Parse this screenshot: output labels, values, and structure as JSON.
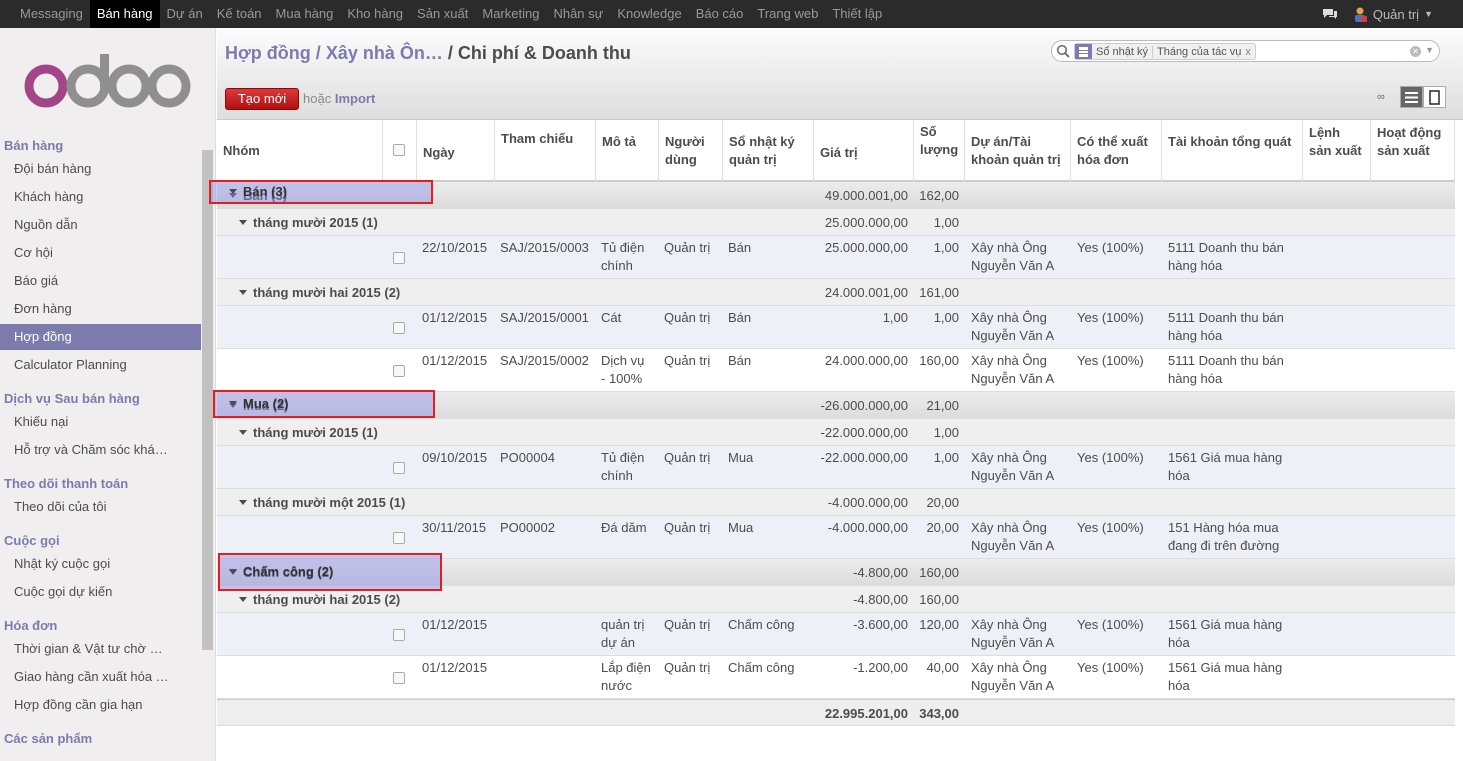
{
  "topbar": {
    "menu": [
      "Messaging",
      "Bán hàng",
      "Dự án",
      "Kế toán",
      "Mua hàng",
      "Kho hàng",
      "Sản xuất",
      "Marketing",
      "Nhân sự",
      "Knowledge",
      "Báo cáo",
      "Trang web",
      "Thiết lập"
    ],
    "active_menu": "Bán hàng",
    "user": "Quản trị"
  },
  "sidebar": {
    "sections": [
      {
        "title": "Bán hàng",
        "items": [
          "Đội bán hàng",
          "Khách hàng",
          "Nguồn dẫn",
          "Cơ hội",
          "Báo giá",
          "Đơn hàng",
          "Hợp đồng",
          "Calculator Planning"
        ]
      },
      {
        "title": "Dịch vụ Sau bán hàng",
        "items": [
          "Khiếu nại",
          "Hỗ trợ và Chăm sóc khá…"
        ]
      },
      {
        "title": "Theo dõi thanh toán",
        "items": [
          "Theo dõi của tôi"
        ]
      },
      {
        "title": "Cuộc gọi",
        "items": [
          "Nhật ký cuộc gọi",
          "Cuộc gọi dự kiến"
        ]
      },
      {
        "title": "Hóa đơn",
        "items": [
          "Thời gian & Vật tư chờ …",
          "Giao hàng cần xuất hóa …",
          "Hợp đồng cần gia hạn"
        ]
      },
      {
        "title": "Các sản phẩm",
        "items": []
      }
    ],
    "active_item": "Hợp đồng"
  },
  "header": {
    "breadcrumb_1": "Hợp đồng",
    "sep": "/",
    "breadcrumb_2": "Xây nhà Ôn…",
    "current": "/ Chi phí & Doanh thu",
    "search": {
      "facet_field": "Sổ nhật ký",
      "facet_value": "Tháng của tác vụ",
      "facet_remove": "x"
    },
    "create_label": "Tạo mới",
    "or_label": "hoặc",
    "import_label": "Import",
    "pager": "∞"
  },
  "table": {
    "columns": [
      "Nhóm",
      "Ngày",
      "Tham chiếu",
      "Mô tả",
      "Người dùng",
      "Sổ nhật ký quản trị",
      "Giá trị",
      "Số lượng",
      "Dự án/Tài khoản quản trị",
      "Có thể xuất hóa đơn",
      "Tài khoản tổng quát",
      "Lệnh sản xuất",
      "Hoạt động sản xuất"
    ],
    "groups": {
      "ban": {
        "label": "Bán (3)",
        "value": "49.000.001,00",
        "qty": "162,00"
      },
      "ban_oct": {
        "label": "tháng mười 2015 (1)",
        "value": "25.000.000,00",
        "qty": "1,00"
      },
      "ban_dec": {
        "label": "tháng mười hai 2015 (2)",
        "value": "24.000.001,00",
        "qty": "161,00"
      },
      "mua": {
        "label": "Mua (2)",
        "value": "-26.000.000,00",
        "qty": "21,00"
      },
      "mua_oct": {
        "label": "tháng mười 2015 (1)",
        "value": "-22.000.000,00",
        "qty": "1,00"
      },
      "mua_nov": {
        "label": "tháng mười một 2015 (1)",
        "value": "-4.000.000,00",
        "qty": "20,00"
      },
      "cc": {
        "label": "Chấm công (2)",
        "value": "-4.800,00",
        "qty": "160,00"
      },
      "cc_dec": {
        "label": "tháng mười hai 2015 (2)",
        "value": "-4.800,00",
        "qty": "160,00"
      }
    },
    "rows": [
      {
        "date": "22/10/2015",
        "ref": "SAJ/2015/0003",
        "desc1": "Tủ điện",
        "desc2": "chính",
        "user": "Quản trị",
        "journal": "Bán",
        "value": "25.000.000,00",
        "qty": "1,00",
        "proj1": "Xây nhà Ông",
        "proj2": "Nguyễn Văn A",
        "inv": "Yes (100%)",
        "acc1": "5111 Doanh thu bán",
        "acc2": "hàng hóa"
      },
      {
        "date": "01/12/2015",
        "ref": "SAJ/2015/0001",
        "desc1": "Cát",
        "desc2": "",
        "user": "Quản trị",
        "journal": "Bán",
        "value": "1,00",
        "qty": "1,00",
        "proj1": "Xây nhà Ông",
        "proj2": "Nguyễn Văn A",
        "inv": "Yes (100%)",
        "acc1": "5111 Doanh thu bán",
        "acc2": "hàng hóa"
      },
      {
        "date": "01/12/2015",
        "ref": "SAJ/2015/0002",
        "desc1": "Dịch vụ",
        "desc2": "- 100%",
        "user": "Quản trị",
        "journal": "Bán",
        "value": "24.000.000,00",
        "qty": "160,00",
        "proj1": "Xây nhà Ông",
        "proj2": "Nguyễn Văn A",
        "inv": "Yes (100%)",
        "acc1": "5111 Doanh thu bán",
        "acc2": "hàng hóa"
      },
      {
        "date": "09/10/2015",
        "ref": "PO00004",
        "desc1": "Tủ điện",
        "desc2": "chính",
        "user": "Quản trị",
        "journal": "Mua",
        "value": "-22.000.000,00",
        "qty": "1,00",
        "proj1": "Xây nhà Ông",
        "proj2": "Nguyễn Văn A",
        "inv": "Yes (100%)",
        "acc1": "1561 Giá mua hàng",
        "acc2": "hóa"
      },
      {
        "date": "30/11/2015",
        "ref": "PO00002",
        "desc1": "Đá dăm",
        "desc2": "",
        "user": "Quản trị",
        "journal": "Mua",
        "value": "-4.000.000,00",
        "qty": "20,00",
        "proj1": "Xây nhà Ông",
        "proj2": "Nguyễn Văn A",
        "inv": "Yes (100%)",
        "acc1": "151 Hàng hóa mua",
        "acc2": "đang đi trên đường"
      },
      {
        "date": "01/12/2015",
        "ref": "",
        "desc1": "quản trị",
        "desc2": "dự án",
        "user": "Quản trị",
        "journal": "Chấm công",
        "value": "-3.600,00",
        "qty": "120,00",
        "proj1": "Xây nhà Ông",
        "proj2": "Nguyễn Văn A",
        "inv": "Yes (100%)",
        "acc1": "1561 Giá mua hàng",
        "acc2": "hóa"
      },
      {
        "date": "01/12/2015",
        "ref": "",
        "desc1": "Lắp điện",
        "desc2": "nước",
        "user": "Quản trị",
        "journal": "Chấm công",
        "value": "-1.200,00",
        "qty": "40,00",
        "proj1": "Xây nhà Ông",
        "proj2": "Nguyễn Văn A",
        "inv": "Yes (100%)",
        "acc1": "1561 Giá mua hàng",
        "acc2": "hóa"
      }
    ],
    "total": {
      "value": "22.995.201,00",
      "qty": "343,00"
    }
  },
  "colors": {
    "accent": "#7c7bad",
    "create": "#c01717",
    "topbar": "#2b2b2b",
    "highlight_border": "#e02020"
  }
}
